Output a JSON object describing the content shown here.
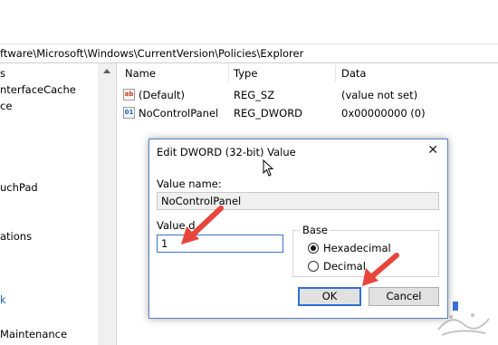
{
  "address_bar": {
    "path": "ftware\\Microsoft\\Windows\\CurrentVersion\\Policies\\Explorer"
  },
  "tree": {
    "items": [
      {
        "label": "s"
      },
      {
        "label": "nterfaceCache"
      },
      {
        "label": "ce"
      },
      {
        "label": "uchPad"
      },
      {
        "label": "ations"
      },
      {
        "label": "k"
      },
      {
        "label": "Maintenance"
      }
    ]
  },
  "list": {
    "columns": [
      "Name",
      "Type",
      "Data"
    ],
    "rows": [
      {
        "icon": "string-value-icon",
        "icon_text": "ab",
        "name": "(Default)",
        "type": "REG_SZ",
        "data": "(value not set)"
      },
      {
        "icon": "binary-value-icon",
        "icon_text": "01",
        "name": "NoControlPanel",
        "type": "REG_DWORD",
        "data": "0x00000000 (0)"
      }
    ]
  },
  "dialog": {
    "title": "Edit DWORD (32-bit) Value",
    "close_glyph": "✕",
    "value_name_label": "Value name:",
    "value_name": "NoControlPanel",
    "value_data_label": "Value d",
    "value_data": "1",
    "base_label": "Base",
    "base_options": [
      {
        "label": "Hexadecimal",
        "selected": true
      },
      {
        "label": "Decimal",
        "selected": false
      }
    ],
    "ok_label": "OK",
    "cancel_label": "Cancel"
  },
  "colors": {
    "annotation_arrow": "#e8453c",
    "accent": "#2f6fd0"
  }
}
